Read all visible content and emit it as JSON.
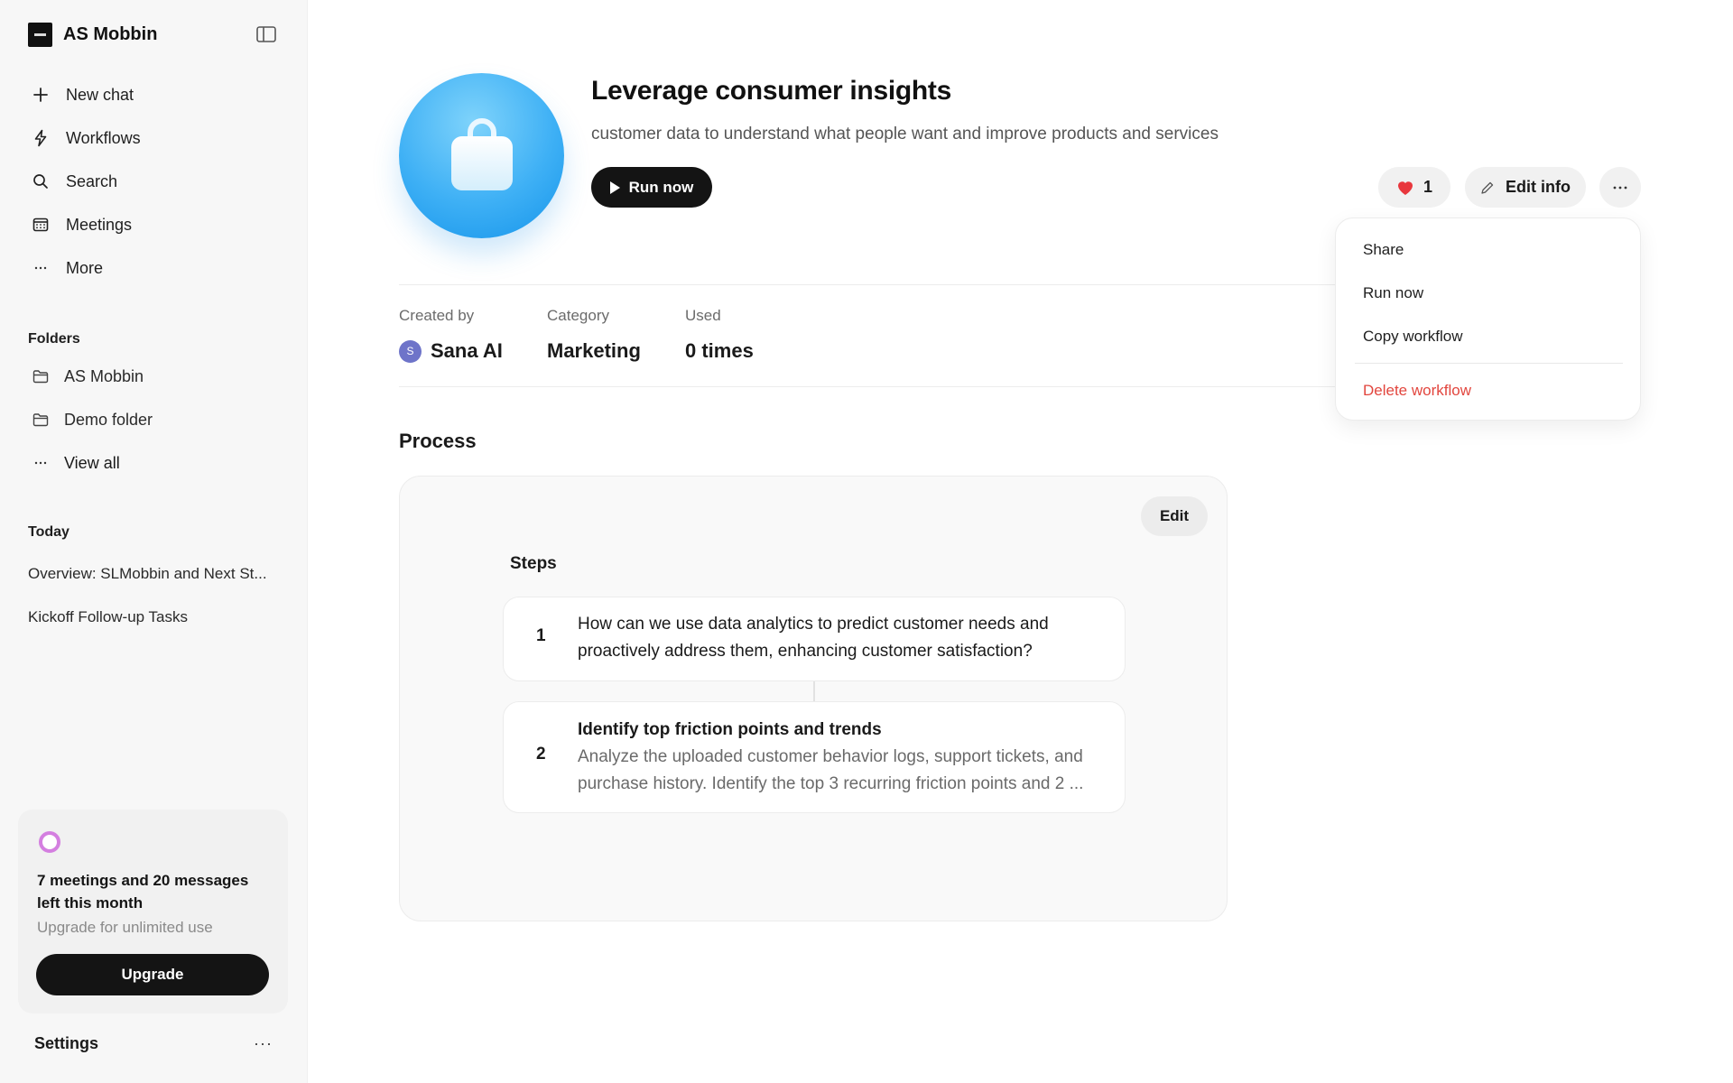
{
  "sidebar": {
    "workspace_name": "AS Mobbin",
    "nav": [
      {
        "label": "New chat",
        "icon": "plus-icon"
      },
      {
        "label": "Workflows",
        "icon": "lightning-icon"
      },
      {
        "label": "Search",
        "icon": "search-icon"
      },
      {
        "label": "Meetings",
        "icon": "calendar-icon"
      },
      {
        "label": "More",
        "icon": "ellipsis-icon"
      }
    ],
    "folders_title": "Folders",
    "folders": [
      {
        "label": "AS Mobbin",
        "icon": "folder-icon"
      },
      {
        "label": "Demo folder",
        "icon": "folder-icon"
      }
    ],
    "view_all_label": "View all",
    "today_title": "Today",
    "today_items": [
      "Overview: SLMobbin and Next St...",
      "Kickoff Follow-up Tasks"
    ],
    "usage": {
      "message": "7 meetings and 20 messages left this month",
      "sub": "Upgrade for unlimited use",
      "button_label": "Upgrade"
    },
    "settings_label": "Settings"
  },
  "workflow": {
    "title": "Leverage consumer insights",
    "description": "customer data to understand what people want and improve products and services",
    "run_label": "Run now",
    "likes": "1",
    "edit_info_label": "Edit info",
    "accent": "#2ea6f2"
  },
  "meta": {
    "created_by_label": "Created by",
    "created_by_initial": "S",
    "created_by_value": "Sana AI",
    "category_label": "Category",
    "category_value": "Marketing",
    "used_label": "Used",
    "used_value": "0 times"
  },
  "process": {
    "title": "Process",
    "edit_label": "Edit",
    "steps_title": "Steps",
    "steps": [
      {
        "num": "1",
        "text": "How can we use data analytics to predict customer needs and proactively address them, enhancing customer satisfaction?"
      },
      {
        "num": "2",
        "title": "Identify top friction points and trends",
        "desc": "Analyze the uploaded customer behavior logs, support tickets, and purchase history. Identify the top 3 recurring friction points and 2 ..."
      }
    ]
  },
  "menu": {
    "items": [
      "Share",
      "Run now",
      "Copy workflow"
    ],
    "danger_item": "Delete workflow",
    "danger_color": "#e2463e"
  }
}
